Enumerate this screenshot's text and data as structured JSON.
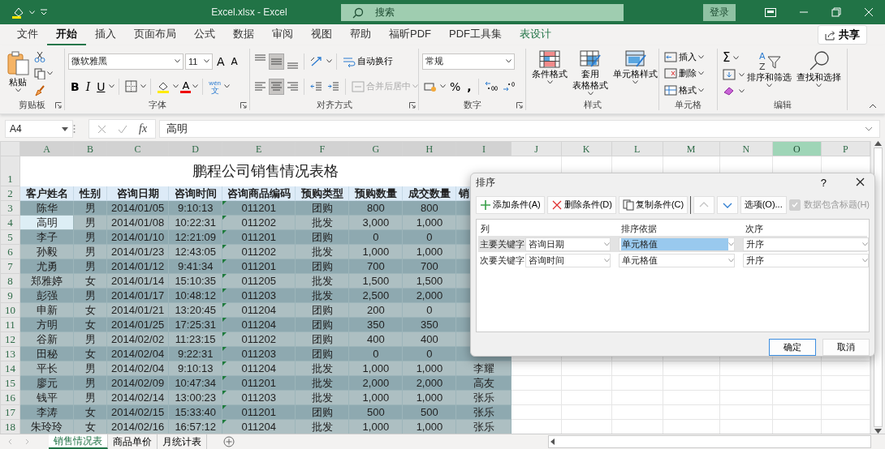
{
  "title_bar": {
    "title": "Excel.xlsx  -  Excel",
    "search_placeholder": "搜索",
    "sign_in": "登录"
  },
  "ribbon_tabs": [
    {
      "label": "文件",
      "selected": false,
      "kind": "normal"
    },
    {
      "label": "开始",
      "selected": true,
      "kind": "normal"
    },
    {
      "label": "插入",
      "selected": false,
      "kind": "normal"
    },
    {
      "label": "页面布局",
      "selected": false,
      "kind": "normal"
    },
    {
      "label": "公式",
      "selected": false,
      "kind": "normal"
    },
    {
      "label": "数据",
      "selected": false,
      "kind": "normal"
    },
    {
      "label": "审阅",
      "selected": false,
      "kind": "normal"
    },
    {
      "label": "视图",
      "selected": false,
      "kind": "normal"
    },
    {
      "label": "帮助",
      "selected": false,
      "kind": "normal"
    },
    {
      "label": "福昕PDF",
      "selected": false,
      "kind": "normal"
    },
    {
      "label": "PDF工具集",
      "selected": false,
      "kind": "normal"
    },
    {
      "label": "表设计",
      "selected": false,
      "kind": "contextual"
    }
  ],
  "share_button": "共享",
  "ribbon_groups": [
    {
      "kind": "clipboard",
      "label": "剪贴板",
      "launcher": true,
      "paste": "粘贴"
    },
    {
      "kind": "font",
      "label": "字体",
      "launcher": true,
      "font_name": "微软雅黑",
      "font_size": "11",
      "grow": "A",
      "shrink": "A",
      "bold": "B",
      "italic": "I",
      "underline": "U",
      "font_color": "A",
      "phonetic": "wén",
      "phonetic_char": "文"
    },
    {
      "kind": "alignment",
      "label": "对齐方式",
      "launcher": true,
      "wrap_text": "自动换行",
      "merge": "合并后居中",
      "merge_disabled": true,
      "vertical": [
        {
          "kind": "top",
          "selected": false
        },
        {
          "kind": "middle",
          "selected": true
        },
        {
          "kind": "bottom",
          "selected": false
        }
      ],
      "horizontal": [
        {
          "kind": "left",
          "selected": false
        },
        {
          "kind": "center",
          "selected": true
        },
        {
          "kind": "right",
          "selected": false
        }
      ]
    },
    {
      "kind": "number",
      "label": "数字",
      "launcher": true,
      "format": "常规",
      "percent": "%",
      "comma": ","
    },
    {
      "kind": "styles",
      "label": "样式",
      "launcher": false,
      "conditional": "条件格式",
      "table_format": [
        "套用",
        "表格格式"
      ],
      "cell_styles": "单元格样式"
    },
    {
      "kind": "cells",
      "label": "单元格",
      "launcher": false,
      "insert": "插入",
      "delete": "删除",
      "format": "格式"
    },
    {
      "kind": "editing",
      "label": "编辑",
      "launcher": false,
      "sum": "Σ",
      "sort_letters": [
        "A",
        "Z"
      ],
      "sort_filter": "排序和筛选",
      "find_select": "查找和选择"
    }
  ],
  "formula_bar": {
    "name_box": "A4",
    "fx": "fx",
    "formula": "高明"
  },
  "sheet": {
    "column_headers": [
      {
        "label": "A",
        "highlighted": true,
        "selected": false
      },
      {
        "label": "B",
        "highlighted": true,
        "selected": false
      },
      {
        "label": "C",
        "highlighted": true,
        "selected": false
      },
      {
        "label": "D",
        "highlighted": true,
        "selected": false
      },
      {
        "label": "E",
        "highlighted": true,
        "selected": false
      },
      {
        "label": "F",
        "highlighted": true,
        "selected": false
      },
      {
        "label": "G",
        "highlighted": true,
        "selected": false
      },
      {
        "label": "H",
        "highlighted": true,
        "selected": false
      },
      {
        "label": "I",
        "highlighted": true,
        "selected": false
      },
      {
        "label": "J",
        "highlighted": false,
        "selected": false
      },
      {
        "label": "K",
        "highlighted": false,
        "selected": false
      },
      {
        "label": "L",
        "highlighted": false,
        "selected": false
      },
      {
        "label": "M",
        "highlighted": false,
        "selected": false
      },
      {
        "label": "N",
        "highlighted": false,
        "selected": false
      },
      {
        "label": "O",
        "highlighted": false,
        "selected": true
      },
      {
        "label": "P",
        "highlighted": false,
        "selected": false
      }
    ],
    "title_row": "1",
    "title": "鹏程公司销售情况表格",
    "header_row": "2",
    "columns": [
      {
        "label": "客户姓名",
        "flagged": false
      },
      {
        "label": "性别",
        "flagged": false
      },
      {
        "label": "咨询日期",
        "flagged": false
      },
      {
        "label": "咨询时间",
        "flagged": false
      },
      {
        "label": "咨询商品编码",
        "flagged": true
      },
      {
        "label": "预购类型",
        "flagged": false
      },
      {
        "label": "预购数量",
        "flagged": false
      },
      {
        "label": "成交数量",
        "flagged": false
      },
      {
        "label": "销",
        "flagged": false
      }
    ],
    "rows": [
      {
        "number": "3",
        "active": false,
        "cells": [
          "陈华",
          "男",
          "2014/01/05",
          "9:10:13",
          "011201",
          "团购",
          "800",
          "800"
        ]
      },
      {
        "number": "4",
        "active": true,
        "cells": [
          "高明",
          "男",
          "2014/01/08",
          "10:22:31",
          "011202",
          "批发",
          "3,000",
          "1,000"
        ]
      },
      {
        "number": "5",
        "active": false,
        "cells": [
          "李子",
          "男",
          "2014/01/10",
          "12:21:09",
          "011201",
          "团购",
          "0",
          "0"
        ]
      },
      {
        "number": "6",
        "active": false,
        "cells": [
          "孙毅",
          "男",
          "2014/01/23",
          "12:43:05",
          "011202",
          "批发",
          "1,000",
          "1,000"
        ]
      },
      {
        "number": "7",
        "active": false,
        "cells": [
          "尤勇",
          "男",
          "2014/01/12",
          "9:41:34",
          "011201",
          "团购",
          "700",
          "700"
        ]
      },
      {
        "number": "8",
        "active": false,
        "cells": [
          "郑雅婷",
          "女",
          "2014/01/14",
          "15:10:35",
          "011205",
          "批发",
          "1,500",
          "1,500"
        ]
      },
      {
        "number": "9",
        "active": false,
        "cells": [
          "彭强",
          "男",
          "2014/01/17",
          "10:48:12",
          "011203",
          "批发",
          "2,500",
          "2,000"
        ]
      },
      {
        "number": "10",
        "active": false,
        "cells": [
          "申新",
          "女",
          "2014/01/21",
          "13:20:45",
          "011204",
          "团购",
          "200",
          "0"
        ]
      },
      {
        "number": "11",
        "active": false,
        "cells": [
          "方明",
          "女",
          "2014/01/25",
          "17:25:31",
          "011204",
          "团购",
          "350",
          "350"
        ]
      },
      {
        "number": "12",
        "active": false,
        "cells": [
          "谷新",
          "男",
          "2014/02/02",
          "11:23:15",
          "011202",
          "团购",
          "400",
          "400"
        ]
      },
      {
        "number": "13",
        "active": false,
        "cells": [
          "田秘",
          "女",
          "2014/02/04",
          "9:22:31",
          "011203",
          "团购",
          "0",
          "0"
        ]
      },
      {
        "number": "14",
        "active": false,
        "cells": [
          "平长",
          "男",
          "2014/02/04",
          "9:10:13",
          "011204",
          "批发",
          "1,000",
          "1,000",
          "李耀"
        ]
      },
      {
        "number": "15",
        "active": false,
        "cells": [
          "廖元",
          "男",
          "2014/02/09",
          "10:47:34",
          "011201",
          "批发",
          "2,000",
          "2,000",
          "高友"
        ]
      },
      {
        "number": "16",
        "active": false,
        "cells": [
          "钱平",
          "男",
          "2014/02/14",
          "13:00:23",
          "011203",
          "批发",
          "1,000",
          "1,000",
          "张乐"
        ]
      },
      {
        "number": "17",
        "active": false,
        "cells": [
          "李涛",
          "女",
          "2014/02/15",
          "15:33:40",
          "011201",
          "团购",
          "500",
          "500",
          "张乐"
        ]
      },
      {
        "number": "18",
        "active": false,
        "cells": [
          "朱玲玲",
          "女",
          "2014/02/16",
          "16:57:12",
          "011204",
          "批发",
          "1,000",
          "1,000",
          "张乐"
        ]
      }
    ]
  },
  "sheet_tabs": [
    {
      "label": "销售情况表",
      "selected": true
    },
    {
      "label": "商品单价",
      "selected": false
    },
    {
      "label": "月统计表",
      "selected": false
    }
  ],
  "sort_dialog": {
    "title": "排序",
    "help": "?",
    "toolbar": [
      {
        "kind": "add",
        "label": "添加条件(A)",
        "disabled": false
      },
      {
        "kind": "delete",
        "label": "删除条件(D)",
        "disabled": false
      },
      {
        "kind": "copy",
        "label": "复制条件(C)",
        "disabled": false
      },
      {
        "kind": "up",
        "disabled": true
      },
      {
        "kind": "down",
        "disabled": false
      },
      {
        "kind": "options",
        "label": "选项(O)...",
        "disabled": false
      }
    ],
    "has_headers": {
      "label": "数据包含标题(H)",
      "checked": true,
      "disabled": true
    },
    "headers": [
      "列",
      "排序依据",
      "次序"
    ],
    "levels": [
      {
        "label": "主要关键字",
        "column": "咨询日期",
        "sort_on": "单元格值",
        "order": "升序",
        "selected": true
      },
      {
        "label": "次要关键字",
        "column": "咨询时间",
        "sort_on": "单元格值",
        "order": "升序",
        "selected": false
      }
    ],
    "ok": "确定",
    "cancel": "取消"
  }
}
